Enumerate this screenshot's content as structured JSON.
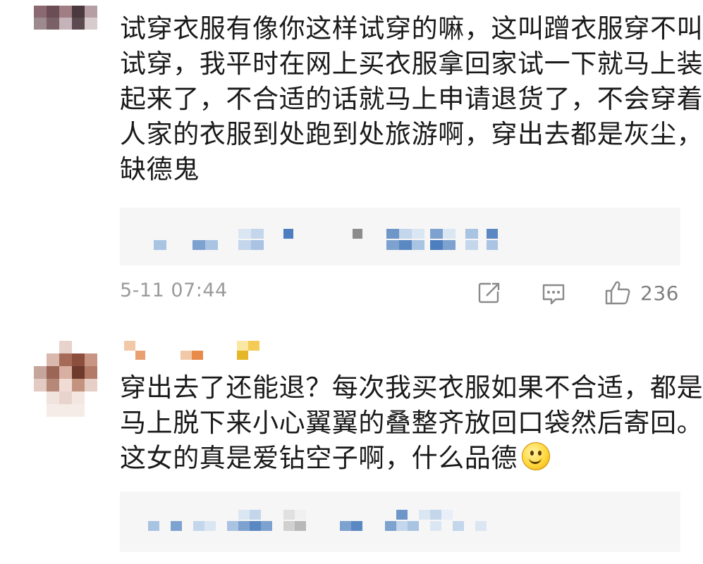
{
  "comments": [
    {
      "text_lines": [
        "试穿衣服有像你这样试穿的嘛，这叫蹭衣服穿不叫",
        "试穿，我平时在网上买衣服拿回家试一下就马上装",
        "起来了，不合适的话就马上申请退货了，不会穿着",
        "人家的衣服到处跑到处旅游啊，穿出去都是灰尘，",
        "缺德鬼"
      ],
      "timestamp": "5-11 07:44",
      "like_count": "236"
    },
    {
      "text_lines": [
        "穿出去了还能退？每次我买衣服如果不合适，都是",
        "马上脱下来小心翼翼的叠整齐放回口袋然后寄回。",
        "这女的真是爱钻空子啊，什么品德"
      ],
      "emoji": "smiley-face"
    }
  ],
  "icons": [
    "share-icon",
    "comment-icon",
    "like-icon"
  ],
  "colors": {
    "text": "#1a1a1a",
    "meta": "#9a9a9a",
    "reply_bg": "#f6f6f6",
    "mosaic_blue": "#5a88c2"
  }
}
